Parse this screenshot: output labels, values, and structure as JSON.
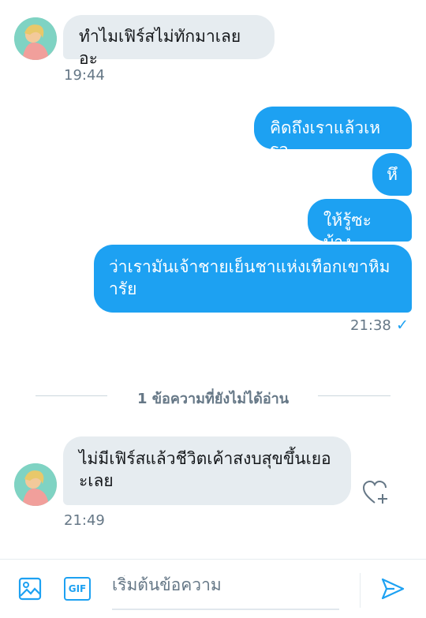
{
  "messages": [
    {
      "side": "in",
      "text": "ทำไมเฟิร์สไม่ทักมาเลยอะ"
    },
    {
      "side": "out",
      "text": "คิดถึงเราแล้วเหรอ"
    },
    {
      "side": "out",
      "text": "หึ"
    },
    {
      "side": "out",
      "text": "ให้รู้ซะบ้าง"
    },
    {
      "side": "out",
      "text": "ว่าเรามันเจ้าชายเย็นชาแห่งเทือกเขาหิมารัย"
    },
    {
      "side": "in",
      "text": "ไม่มีเฟิร์สแล้วชีวิตเค้าสงบสุขขึ้นเยอะเลย"
    }
  ],
  "timestamps": {
    "first": "19:44",
    "sent": "21:38",
    "last": "21:49"
  },
  "read_status": "✓",
  "unread_divider": "1 ข้อความที่ยังไม่ได้อ่าน",
  "composer": {
    "placeholder": "เริ่มต้นข้อความ",
    "gif_label": "GIF"
  },
  "colors": {
    "accent": "#1da1f2",
    "incoming_bubble": "#e6ecf0",
    "muted": "#657786"
  }
}
